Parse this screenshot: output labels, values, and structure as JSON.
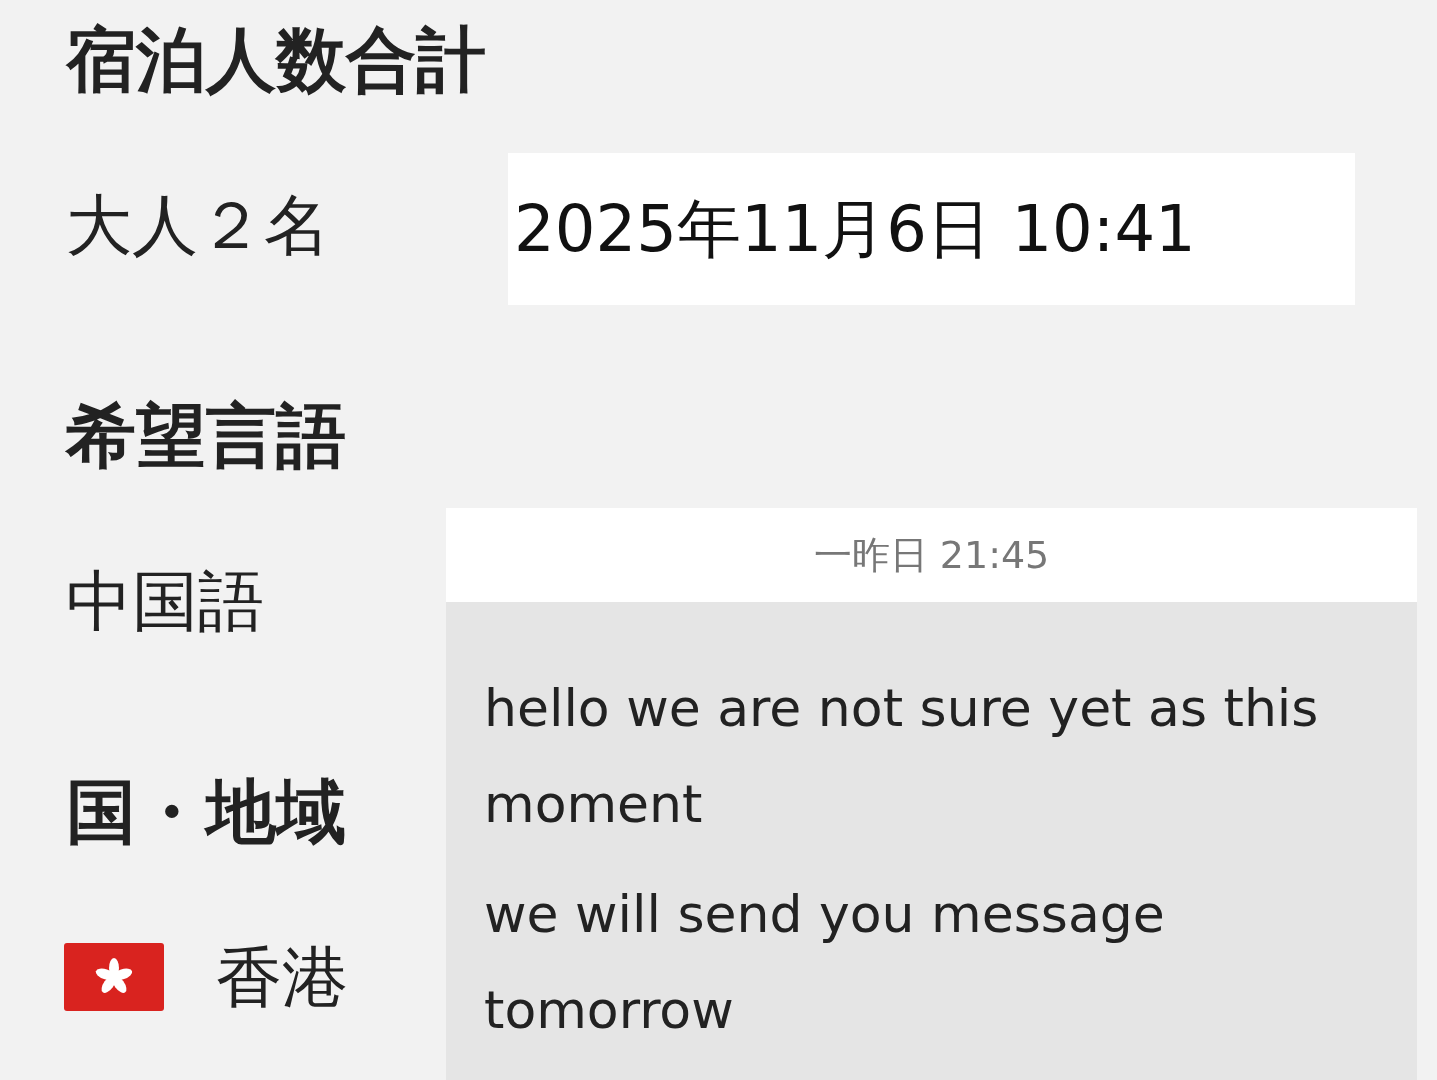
{
  "sections": [
    {
      "kind": "text",
      "heading": "宿泊人数合計",
      "value": "大人２名"
    },
    {
      "kind": "text",
      "heading": "希望言語",
      "value": "中国語"
    },
    {
      "kind": "country",
      "heading": "国・地域",
      "value": "香港"
    }
  ],
  "date_stamp": "2025年11月6日 10:41",
  "chat": {
    "time": "一昨日 21:45",
    "messages": [
      "hello we are not sure yet as this moment",
      "we will send you message tomorrow"
    ]
  }
}
